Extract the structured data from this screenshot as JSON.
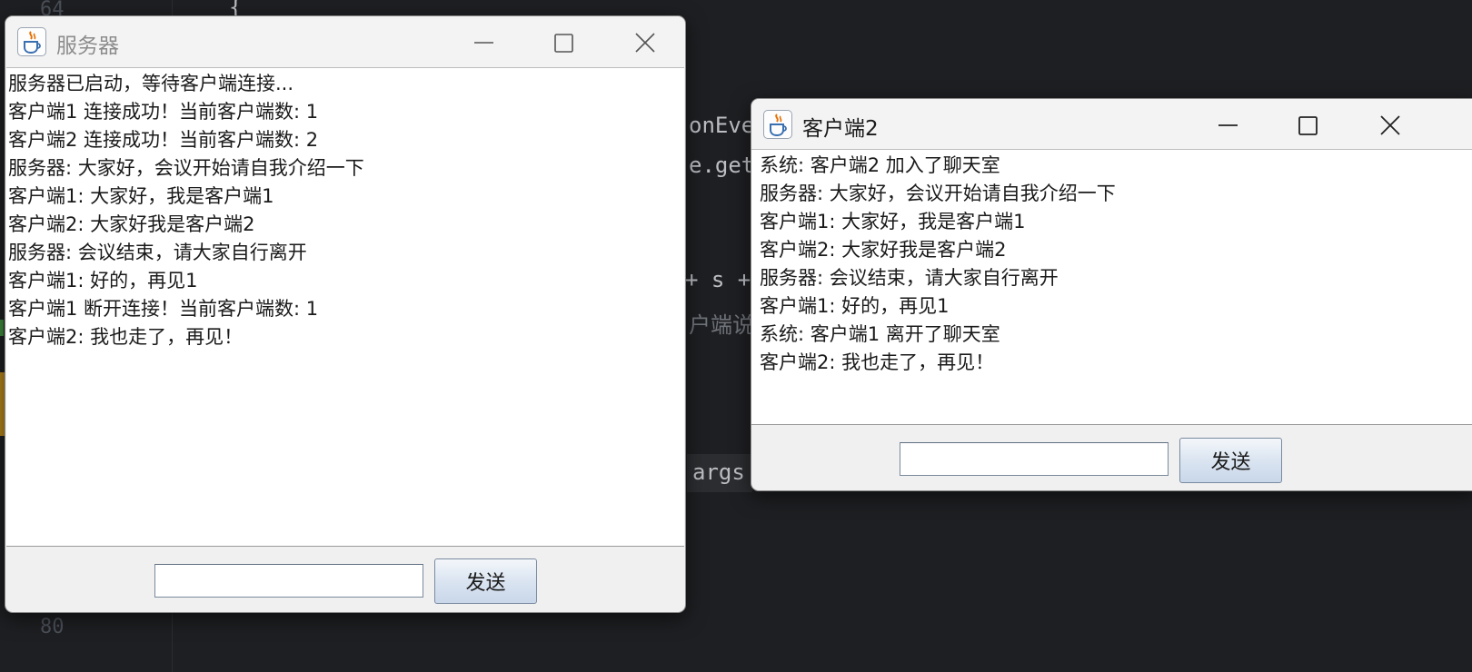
{
  "ide": {
    "line_numbers": [
      "64",
      "80"
    ],
    "code_fragments": {
      "brace": "{",
      "onEvent": "onEve",
      "getcall": "e.get",
      "s_plus": "+ s +",
      "client_said": "户端说",
      "args": "args"
    }
  },
  "server_window": {
    "title": "服务器",
    "title_state": "inactive",
    "messages": [
      "服务器已启动，等待客户端连接...",
      "客户端1 连接成功！当前客户端数: 1",
      "客户端2 连接成功！当前客户端数: 2",
      "服务器: 大家好，会议开始请自我介绍一下",
      "客户端1: 大家好，我是客户端1",
      "客户端2: 大家好我是客户端2",
      "服务器: 会议结束，请大家自行离开",
      "客户端1: 好的，再见1",
      "客户端1 断开连接！当前客户端数: 1",
      "客户端2: 我也走了，再见！"
    ],
    "input_value": "",
    "send_label": "发送"
  },
  "client_window": {
    "title": "客户端2",
    "title_state": "active",
    "messages": [
      "系统: 客户端2 加入了聊天室",
      "服务器: 大家好，会议开始请自我介绍一下",
      "客户端1: 大家好，我是客户端1",
      "客户端2: 大家好我是客户端2",
      "服务器: 会议结束，请大家自行离开",
      "客户端1: 好的，再见1",
      "系统: 客户端1 离开了聊天室",
      "客户端2: 我也走了，再见！"
    ],
    "input_value": "",
    "send_label": "发送"
  },
  "icons": {
    "app": "java-cup-icon",
    "minimize": "minimize-icon",
    "maximize": "maximize-icon",
    "close": "close-icon"
  },
  "colors": {
    "ide_background": "#1e1f22",
    "window_background": "#f0f0f0",
    "chat_background": "#ffffff",
    "button_gradient_top": "#f4f7fb",
    "button_gradient_bottom": "#c9d7ea"
  }
}
